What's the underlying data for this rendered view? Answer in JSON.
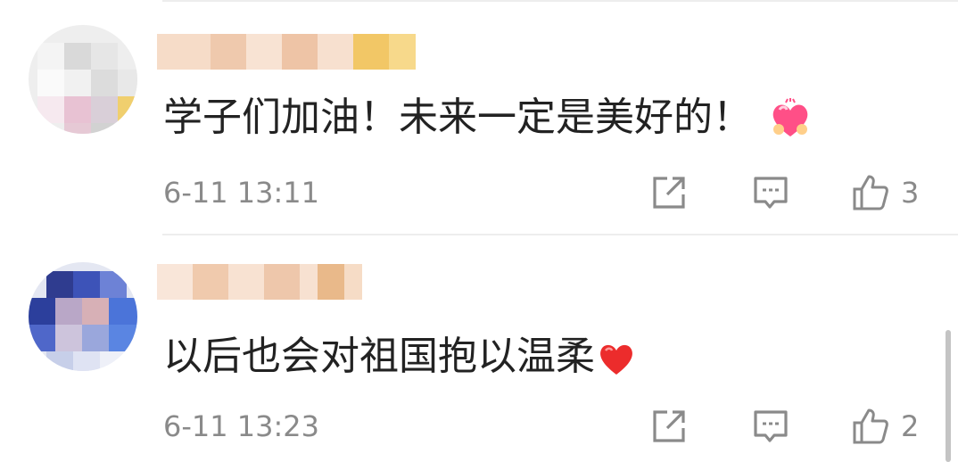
{
  "comments": [
    {
      "text": "学子们加油！未来一定是美好的！",
      "emoji": "heart-hands-emoji",
      "time": "6-11 13:11",
      "likes": "3"
    },
    {
      "text": "以后也会对祖国抱以温柔",
      "emoji": "red-heart-emoji",
      "time": "6-11 13:23",
      "likes": "2"
    }
  ],
  "icons": {
    "share": "share-icon",
    "reply": "comment-icon",
    "like": "thumbs-up-icon"
  },
  "colors": {
    "text": "#222222",
    "meta": "#8a8a8a",
    "divider": "#ededed"
  }
}
